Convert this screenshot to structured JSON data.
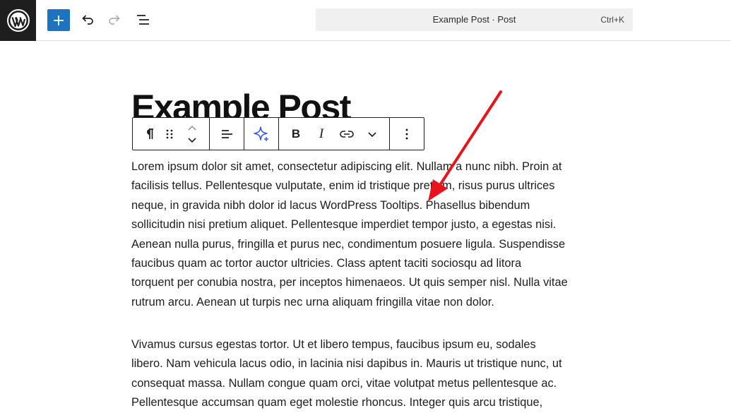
{
  "topbar": {
    "document_title": "Example Post · Post",
    "shortcut": "Ctrl+K"
  },
  "icons": {
    "logo": "wordpress-logo",
    "add": "plus-icon",
    "undo": "undo-icon",
    "redo": "redo-icon",
    "outline": "list-view-icon",
    "paragraph": "pilcrow-icon",
    "drag": "drag-handle-icon",
    "move": "chevron-up-down-icon",
    "align": "align-left-icon",
    "ai": "sparkle-icon",
    "bold": "bold-icon",
    "italic": "italic-icon",
    "link": "link-icon",
    "more_formats": "chevron-down-icon",
    "options": "more-vertical-icon",
    "arrow": "red-arrow-annotation"
  },
  "toolbar": {
    "bold_label": "B",
    "italic_label": "I"
  },
  "post": {
    "title": "Example Post",
    "paragraph1_lines": [
      "Lorem ipsum dolor sit amet, consectetur adipiscing elit. Nullam a nunc nibh. Proin at",
      "facilisis tellus. Pellentesque vulputate, enim id tristique pretium, risus purus ultrices",
      "neque, in gravida nibh dolor id lacus WordPress Tooltips. Phasellus bibendum",
      "sollicitudin nisi pretium aliquet. Pellentesque imperdiet tempor justo, a egestas nisi.",
      "Aenean nulla purus, fringilla et purus nec, condimentum posuere ligula. Suspendisse",
      "faucibus quam ac tortor auctor ultricies. Class aptent taciti sociosqu ad litora",
      "torquent per conubia nostra, per inceptos himenaeos. Ut quis semper nisl. Nulla vitae",
      "rutrum arcu. Aenean ut turpis nec urna aliquam fringilla vitae non dolor."
    ],
    "paragraph2_lines": [
      "Vivamus cursus egestas tortor. Ut et libero tempus, faucibus ipsum eu, sodales",
      "libero. Nam vehicula lacus odio, in lacinia nisi dapibus in. Mauris ut tristique nunc, ut",
      "consequat massa. Nullam congue quam orci, vitae volutpat metus pellentesque ac.",
      "Pellentesque accumsan quam eget molestie rhoncus. Integer quis arcu tristique,"
    ]
  },
  "colors": {
    "accent": "#1e73be",
    "annotation": "#e8141b",
    "dark": "#1e1e1e"
  }
}
